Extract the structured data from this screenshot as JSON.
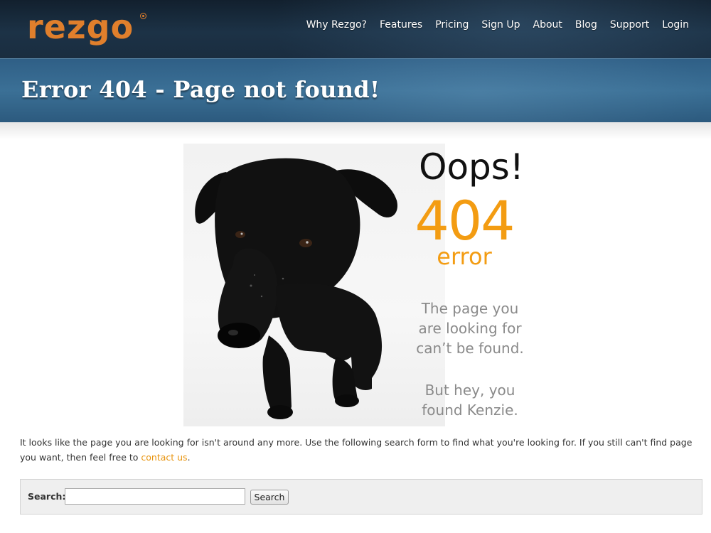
{
  "brand": {
    "logo_text": "rezgo",
    "accent": "#e07f2c"
  },
  "nav": {
    "items": [
      {
        "label": "Why Rezgo?"
      },
      {
        "label": "Features"
      },
      {
        "label": "Pricing"
      },
      {
        "label": "Sign Up"
      },
      {
        "label": "About"
      },
      {
        "label": "Blog"
      },
      {
        "label": "Support"
      },
      {
        "label": "Login"
      }
    ]
  },
  "page": {
    "title": "Error 404 - Page not found!"
  },
  "illustration": {
    "oops": "Oops!",
    "code": "404",
    "error_word": "error",
    "message_1": [
      "The page you",
      "are looking for",
      "can’t be found."
    ],
    "message_2": [
      "But hey, you",
      "found Kenzie."
    ],
    "code_color": "#f39c12",
    "message_color": "#8a8a8a"
  },
  "intro": {
    "text": "It looks like the page you are looking for isn't around any more. Use the following search form to find what you're looking for. If you still can't find page you want, then feel free to ",
    "link_label": "contact us",
    "suffix": ".",
    "link_color": "#e8930c"
  },
  "search": {
    "label": "Search:",
    "value": "",
    "placeholder": "",
    "button_label": "Search"
  }
}
